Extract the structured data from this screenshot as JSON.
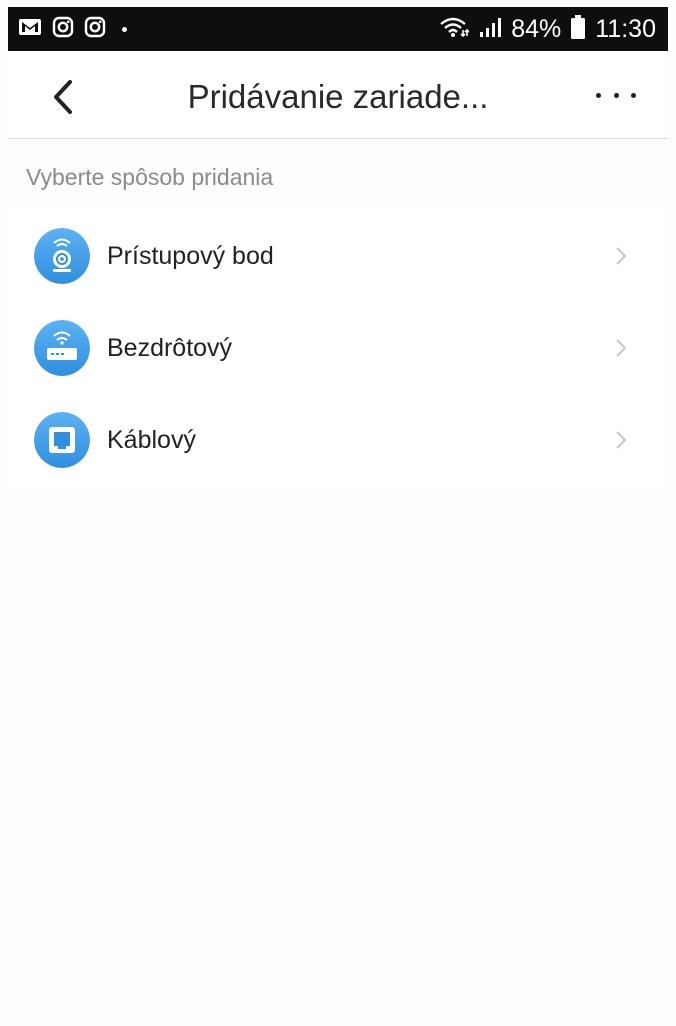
{
  "status_bar": {
    "notification_icons": [
      "gmail-icon",
      "instagram-icon",
      "instagram-icon"
    ],
    "battery": "84%",
    "time": "11:30"
  },
  "header": {
    "title": "Pridávanie zariade...",
    "back_icon": "chevron-left-icon",
    "more_icon": "more-horizontal-icon"
  },
  "section": {
    "label": "Vyberte spôsob pridania"
  },
  "options": [
    {
      "label": "Prístupový bod",
      "icon": "camera-wifi-icon"
    },
    {
      "label": "Bezdrôtový",
      "icon": "router-wifi-icon"
    },
    {
      "label": "Káblový",
      "icon": "ethernet-port-icon"
    }
  ],
  "colors": {
    "accent": "#2f8fe0",
    "accent_light": "#5cb2f3",
    "text": "#222222",
    "muted": "#8b8b8b"
  }
}
